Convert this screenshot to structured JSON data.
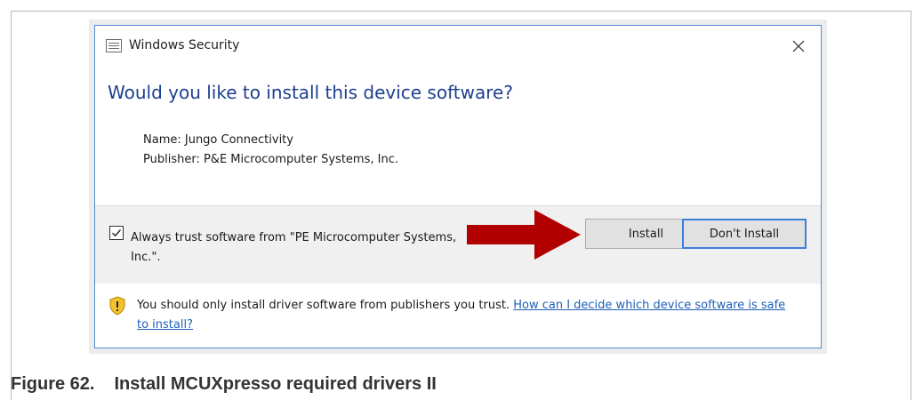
{
  "dialog": {
    "title": "Windows Security",
    "heading": "Would you like to install this device software?",
    "name_line": "Name: Jungo Connectivity",
    "publisher_line": "Publisher: P&E Microcomputer Systems, Inc.",
    "trust_checkbox": {
      "checked": true,
      "label": "Always trust software from \"PE Microcomputer Systems, Inc.\"."
    },
    "install_label": "Install",
    "dont_install_label": "Don't Install",
    "notice_text": "You should only install driver software from publishers you trust.",
    "notice_link": "How can I decide which device software is safe to install?"
  },
  "caption": {
    "label": "Figure 62.",
    "text": "Install MCUXpresso required drivers II"
  },
  "colors": {
    "heading": "#1d3f8f",
    "link": "#1d5fb8",
    "arrow": "#b20000",
    "shield": "#f4c22d",
    "dialog_border": "#4f8dd6"
  },
  "icons": {
    "title": "window-list-icon",
    "close": "close-icon",
    "checkbox": "checkmark-icon",
    "pointer": "red-arrow-icon",
    "warning": "shield-warning-icon"
  }
}
